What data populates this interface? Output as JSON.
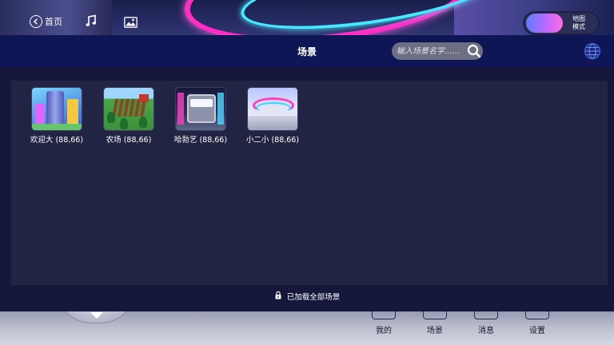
{
  "topbar": {
    "home_label": "首页",
    "map_toggle_label": "地图\n模式",
    "map_toggle_line1": "地图",
    "map_toggle_line2": "模式"
  },
  "panel": {
    "title": "场景",
    "search_placeholder": "输入场景名字......",
    "scenes": [
      {
        "name": "欢迎大 (88,66)",
        "thumbnail": "welcome-city"
      },
      {
        "name": "农场   (88,66)",
        "thumbnail": "farm"
      },
      {
        "name": "哈勃艺 (88,66)",
        "thumbnail": "arcade-building"
      },
      {
        "name": "小二小 (88,66)",
        "thumbnail": "neon-stadium"
      }
    ],
    "footer_status": "已加载全部场景"
  },
  "bottom_nav": [
    {
      "label": "我的"
    },
    {
      "label": "场景"
    },
    {
      "label": "消息"
    },
    {
      "label": "设置"
    }
  ],
  "icons": {
    "back": "back-arrow-icon",
    "music": "music-note-icon",
    "image": "image-icon",
    "search": "magnifier-icon",
    "globe": "globe-icon",
    "loaded": "lock-status-icon"
  },
  "colors": {
    "header_bg": "#0e1656",
    "panel_bg": "#15183a",
    "content_bg": "#222443",
    "neon_pink": "#ff2fc6",
    "neon_cyan": "#46e7ff"
  }
}
